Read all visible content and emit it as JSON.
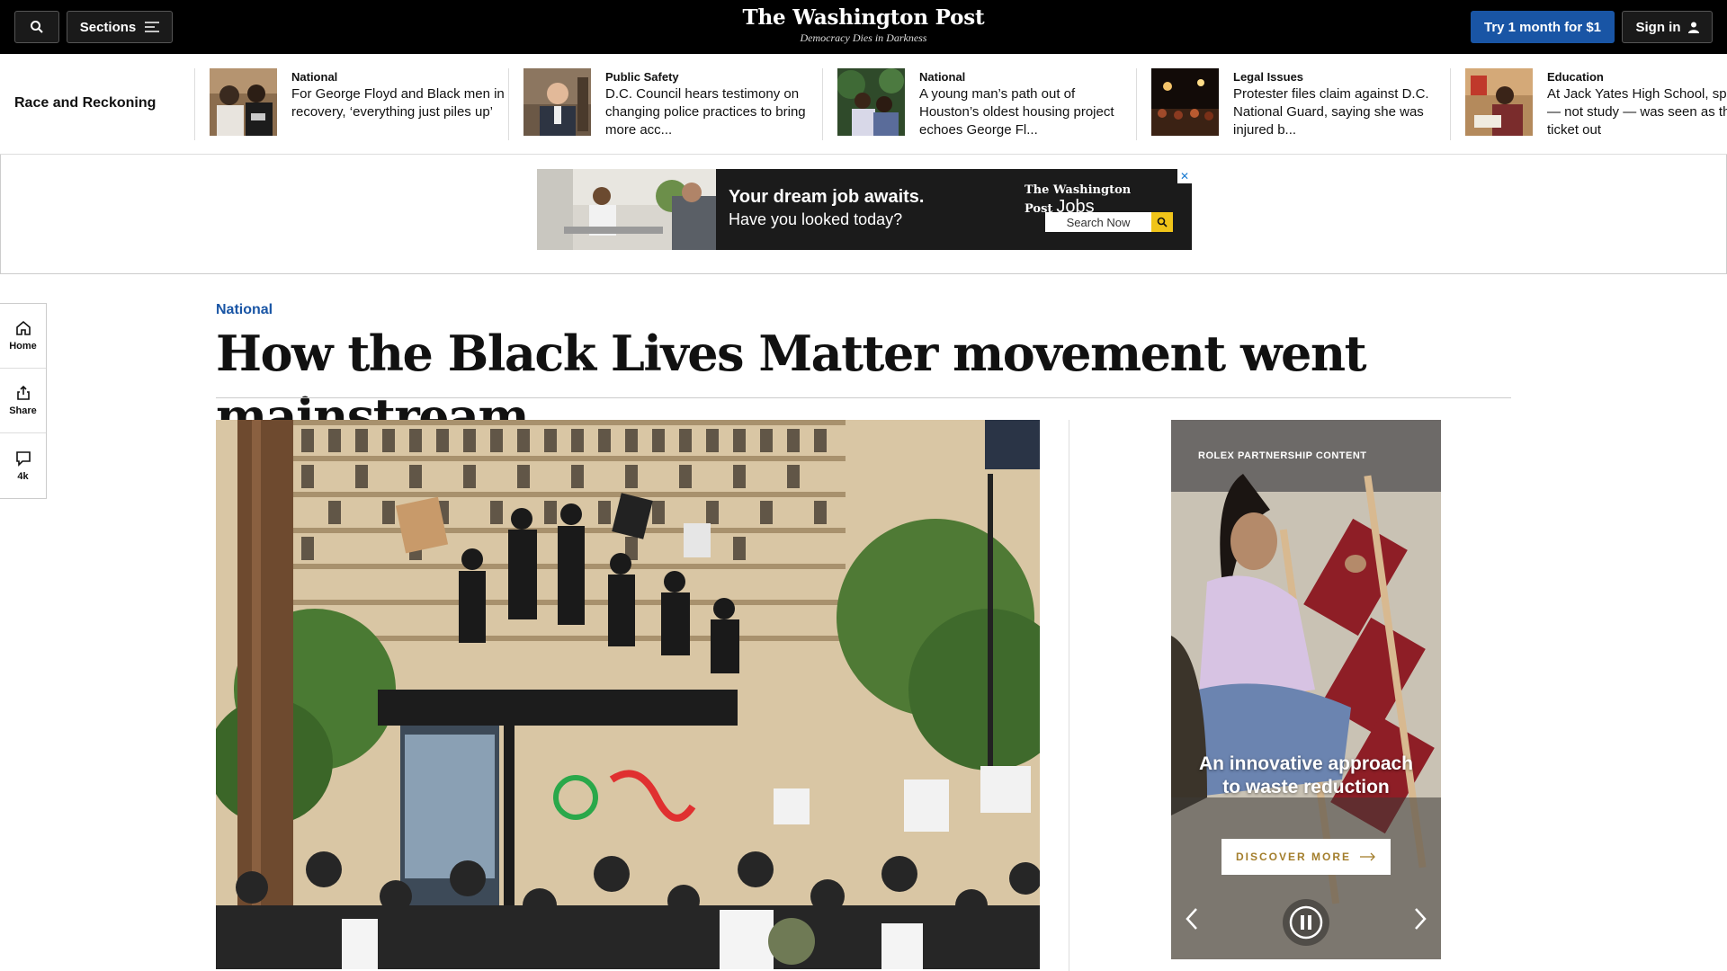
{
  "header": {
    "sections_label": "Sections",
    "brand": "The Washington Post",
    "tagline": "Democracy Dies in Darkness",
    "subscribe_label": "Try 1 month for $1",
    "signin_label": "Sign in"
  },
  "strip": {
    "title": "Race and Reckoning",
    "items": [
      {
        "kicker": "National",
        "headline": "For George Floyd and Black men in recovery, ‘everything just piles up’"
      },
      {
        "kicker": "Public Safety",
        "headline": "D.C. Council hears testimony on changing police practices to bring more acc..."
      },
      {
        "kicker": "National",
        "headline": "A young man’s path out of Houston’s oldest housing project echoes George Fl..."
      },
      {
        "kicker": "Legal Issues",
        "headline": "Protester files claim against D.C. National Guard, saying she was injured b..."
      },
      {
        "kicker": "Education",
        "headline": "At Jack Yates High School, sports — not study — was seen as the ticket out"
      }
    ]
  },
  "jobs_ad": {
    "headline": "Your dream job awaits.",
    "subline": "Have you looked today?",
    "brand": "The Washington Post",
    "brand_suffix": "Jobs",
    "search_label": "Search Now",
    "adchoices": "✕"
  },
  "rail": {
    "home_label": "Home",
    "share_label": "Share",
    "comments_label": "4k"
  },
  "article": {
    "kicker": "National",
    "headline": "How the Black Lives Matter movement went mainstream"
  },
  "rolex_ad": {
    "label": "ROLEX PARTNERSHIP CONTENT",
    "message": "An innovative approach to waste reduction",
    "cta": "DISCOVER MORE"
  },
  "colors": {
    "accent": "#1955a5",
    "topbar": "#000000",
    "rolex_gold": "#a37e2c"
  }
}
